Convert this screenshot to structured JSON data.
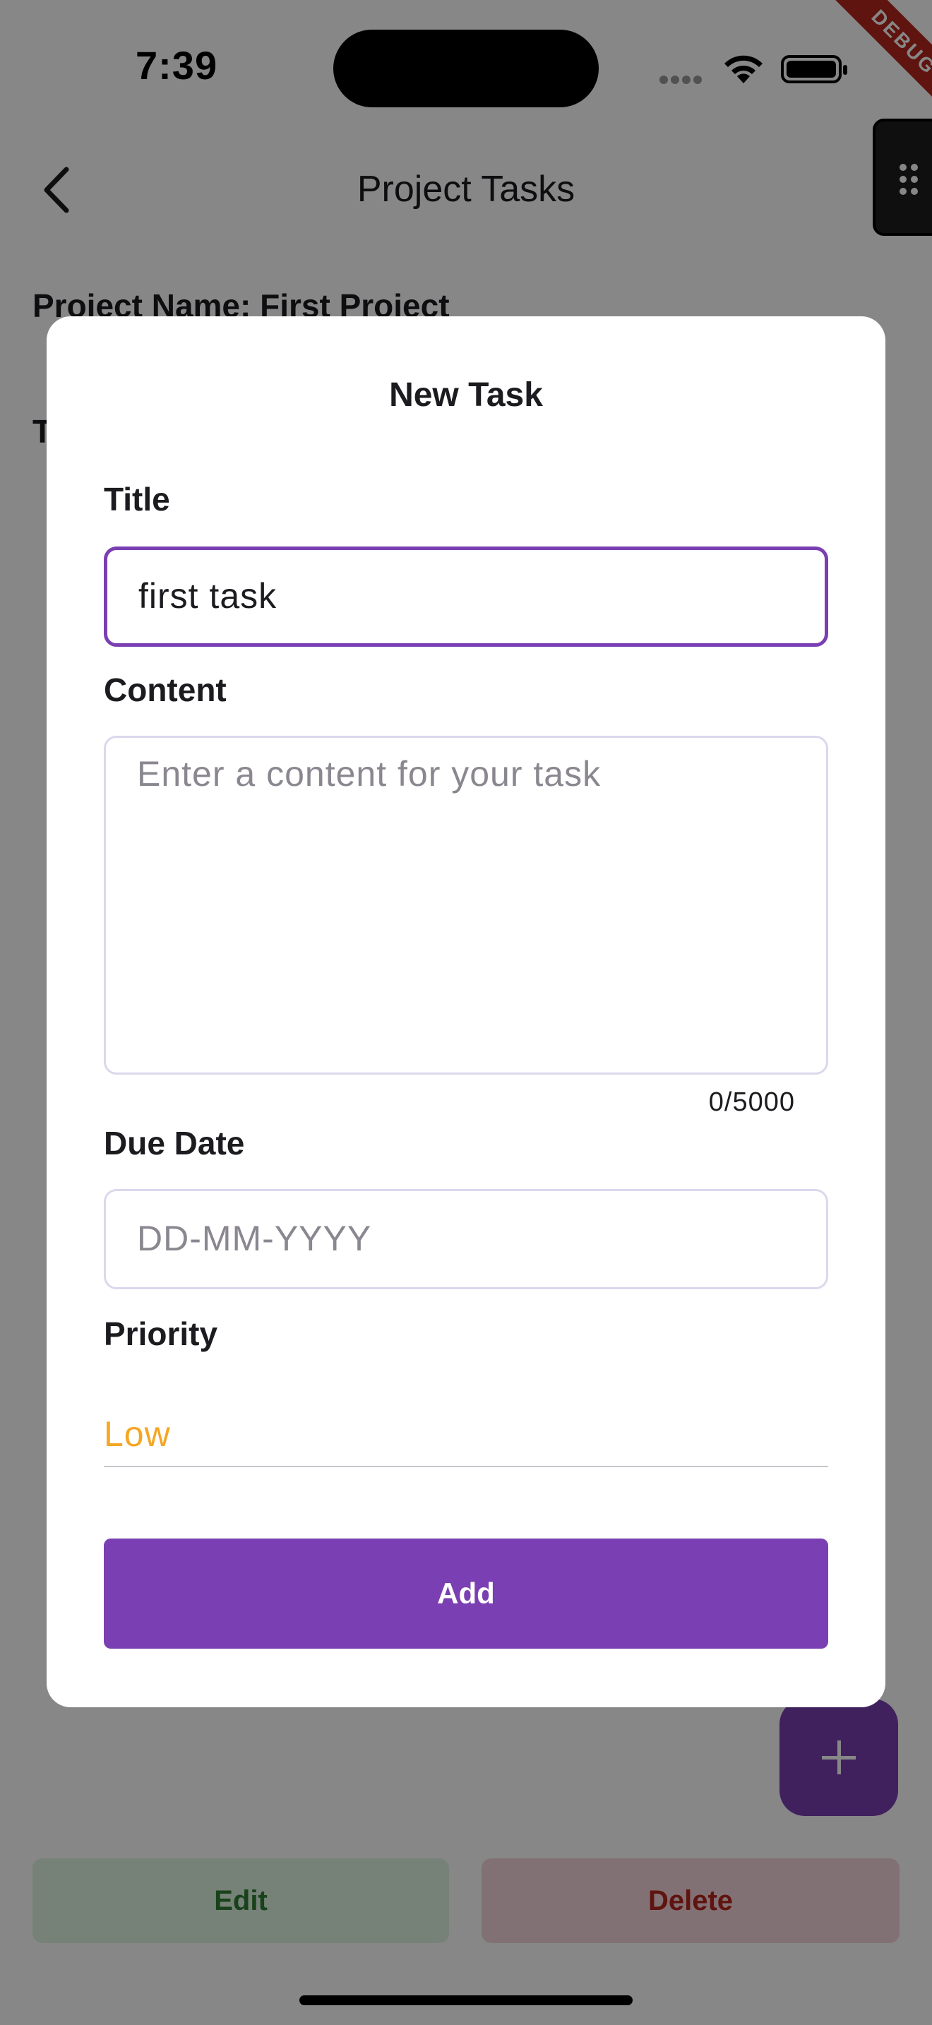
{
  "status_bar": {
    "time": "7:39"
  },
  "debug_banner": "DEBUG",
  "app_bar": {
    "title": "Project Tasks"
  },
  "page": {
    "project_name": "Project Name: First Project",
    "tasks_heading": "T"
  },
  "actions": {
    "edit_label": "Edit",
    "delete_label": "Delete"
  },
  "icons": {
    "back": "chevron-left-icon",
    "fab": "plus-icon",
    "handle": "drag-grip-icon",
    "wifi": "wifi-icon",
    "battery": "battery-icon"
  },
  "dialog": {
    "title": "New Task",
    "title_field": {
      "label": "Title",
      "value": "first task"
    },
    "content_field": {
      "label": "Content",
      "placeholder": "Enter a content for your task",
      "counter": "0/5000"
    },
    "due_date_field": {
      "label": "Due Date",
      "placeholder": "DD-MM-YYYY"
    },
    "priority_field": {
      "label": "Priority",
      "value": "Low"
    },
    "add_label": "Add"
  },
  "colors": {
    "primary": "#7a3fb2",
    "priority_low": "#f5a623",
    "edit": "#2e7d32",
    "delete": "#b3261e"
  }
}
